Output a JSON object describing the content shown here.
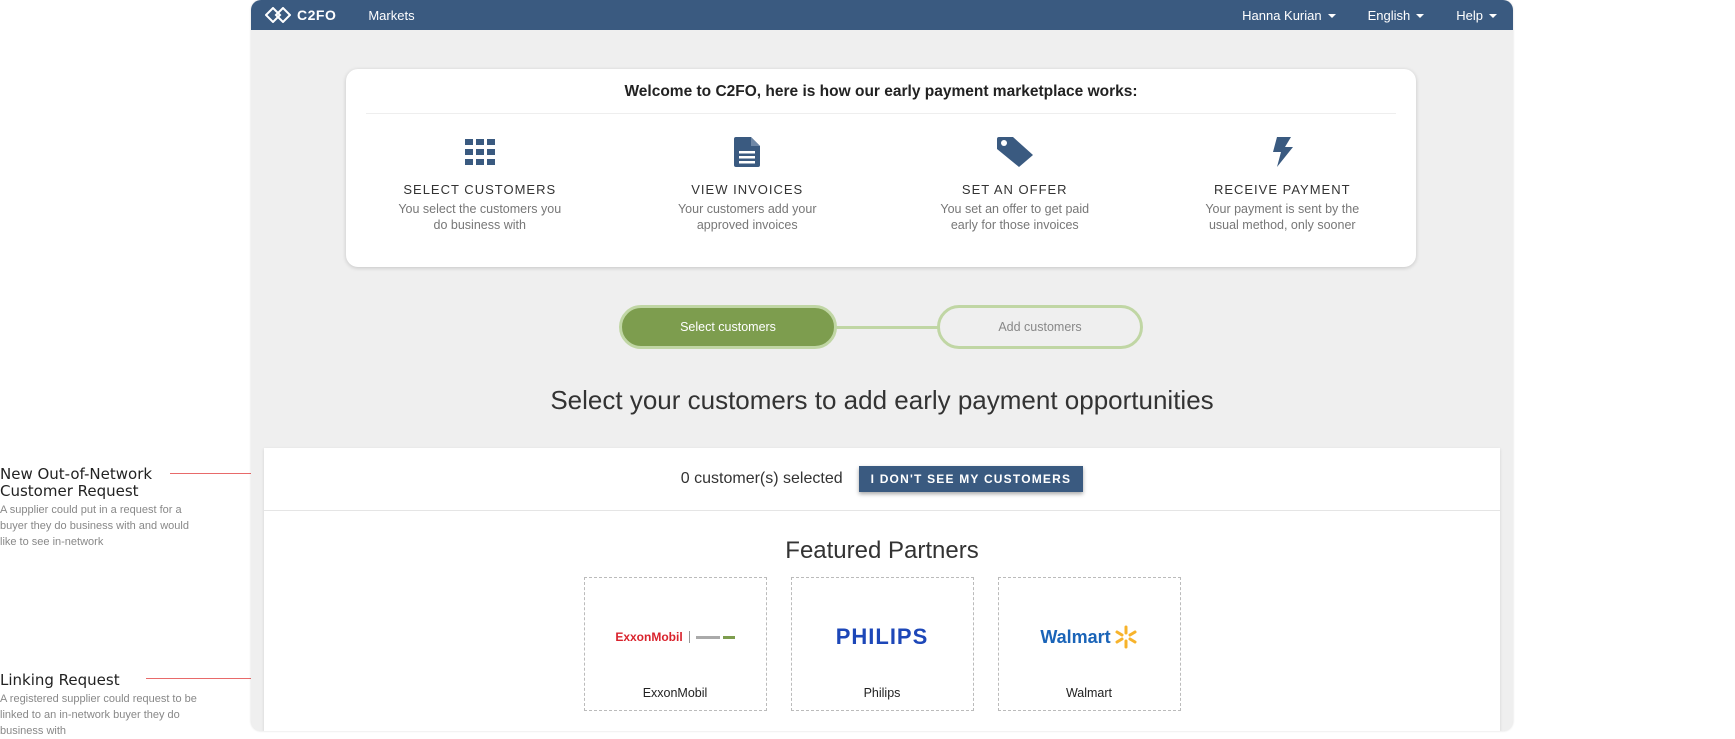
{
  "annotations": [
    {
      "title_line1": "New Out-of-Network",
      "title_line2": "Customer Request",
      "description": "A supplier could put in a request for a buyer they do business with and would like to see in-network"
    },
    {
      "title_line1": "Linking Request",
      "title_line2": "",
      "description": "A registered supplier could request to be linked to an in-network buyer they do business with"
    }
  ],
  "topbar": {
    "logo_text": "C2FO",
    "nav_markets": "Markets",
    "user_menu": "Hanna Kurian",
    "language_menu": "English",
    "help_menu": "Help"
  },
  "welcome": {
    "title": "Welcome to C2FO, here is how our early payment marketplace works:",
    "steps": [
      {
        "icon": "grid-icon",
        "name": "SELECT CUSTOMERS",
        "desc_line1": "You select the customers you",
        "desc_line2": "do business with"
      },
      {
        "icon": "document-icon",
        "name": "VIEW INVOICES",
        "desc_line1": "Your customers add your",
        "desc_line2": "approved invoices"
      },
      {
        "icon": "tag-icon",
        "name": "SET AN OFFER",
        "desc_line1": "You set an offer to get paid",
        "desc_line2": "early for those invoices"
      },
      {
        "icon": "bolt-icon",
        "name": "RECEIVE PAYMENT",
        "desc_line1": "Your payment is sent by the",
        "desc_line2": "usual method, only sooner"
      }
    ]
  },
  "progress": {
    "active_step": "Select customers",
    "next_step": "Add customers"
  },
  "headline": "Select your customers to add early payment opportunities",
  "selection": {
    "count_text": "0 customer(s) selected",
    "missing_button": "I DON'T SEE MY CUSTOMERS"
  },
  "featured": {
    "title": "Featured Partners",
    "partners": [
      {
        "name": "ExxonMobil",
        "logo_text": "ExxonMobil"
      },
      {
        "name": "Philips",
        "logo_text": "PHILIPS"
      },
      {
        "name": "Walmart",
        "logo_text": "Walmart"
      }
    ]
  },
  "colors": {
    "topbar": "#3a5a80",
    "accent_green": "#7d9d4e",
    "annotation_line": "#e86a6a",
    "exxon_red": "#d9232d",
    "philips_blue": "#1d47b8",
    "walmart_blue": "#1a64b8",
    "walmart_yellow": "#f7b32b"
  }
}
